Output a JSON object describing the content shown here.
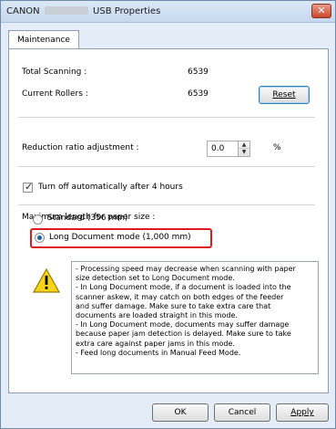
{
  "window": {
    "title_prefix": "CANON",
    "title_suffix": "USB Properties",
    "close_glyph": "✕"
  },
  "tabs": [
    {
      "label": "Maintenance"
    }
  ],
  "counters": {
    "total_label": "Total Scanning :",
    "total_value": "6539",
    "rollers_label": "Current Rollers :",
    "rollers_value": "6539",
    "reset_button": "Reset"
  },
  "reduction": {
    "label": "Reduction ratio adjustment :",
    "value": "0.0",
    "unit": "%"
  },
  "auto_off": {
    "label": "Turn off automatically after 4 hours",
    "checked": true
  },
  "paper_size": {
    "label": "Maximum length for paper size :",
    "options": [
      {
        "label": "Standard (356 mm)",
        "selected": false
      },
      {
        "label": "Long Document mode (1,000 mm)",
        "selected": true
      }
    ]
  },
  "notice": {
    "lines": [
      "- Processing speed may decrease when scanning with paper",
      "size detection set to Long Document mode.",
      "- In Long Document mode, if a document is loaded into the",
      "scanner askew, it may catch on both edges of the feeder",
      "and suffer damage. Make sure to take extra care that",
      "documents are loaded straight in this mode.",
      "- In Long Document mode, documents may suffer damage",
      "because paper jam detection is delayed. Make sure to take",
      "extra care against paper jams in this mode.",
      "- Feed long documents in Manual Feed Mode."
    ]
  },
  "footer": {
    "ok": "OK",
    "cancel": "Cancel",
    "apply": "Apply"
  },
  "colors": {
    "highlight": "#e01b1b",
    "window_frame": "#e4edf7",
    "radio_selected": "#1d5fa8"
  }
}
